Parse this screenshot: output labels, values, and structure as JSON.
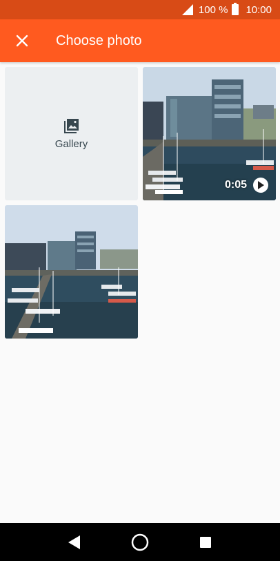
{
  "status_bar": {
    "battery_percent": "100 %",
    "time": "10:00",
    "icons": [
      "signal-icon",
      "battery-icon"
    ]
  },
  "app_bar": {
    "title": "Choose photo",
    "close_icon": "close-icon",
    "background": "#ff5a1f",
    "status_background": "#d84b16"
  },
  "grid": {
    "gallery_label": "Gallery",
    "gallery_icon": "photo-library-icon",
    "video_duration": "0:05",
    "play_icon": "play-circle-icon"
  },
  "nav_bar": {
    "icons": [
      "back-icon",
      "home-icon",
      "recents-icon"
    ]
  }
}
